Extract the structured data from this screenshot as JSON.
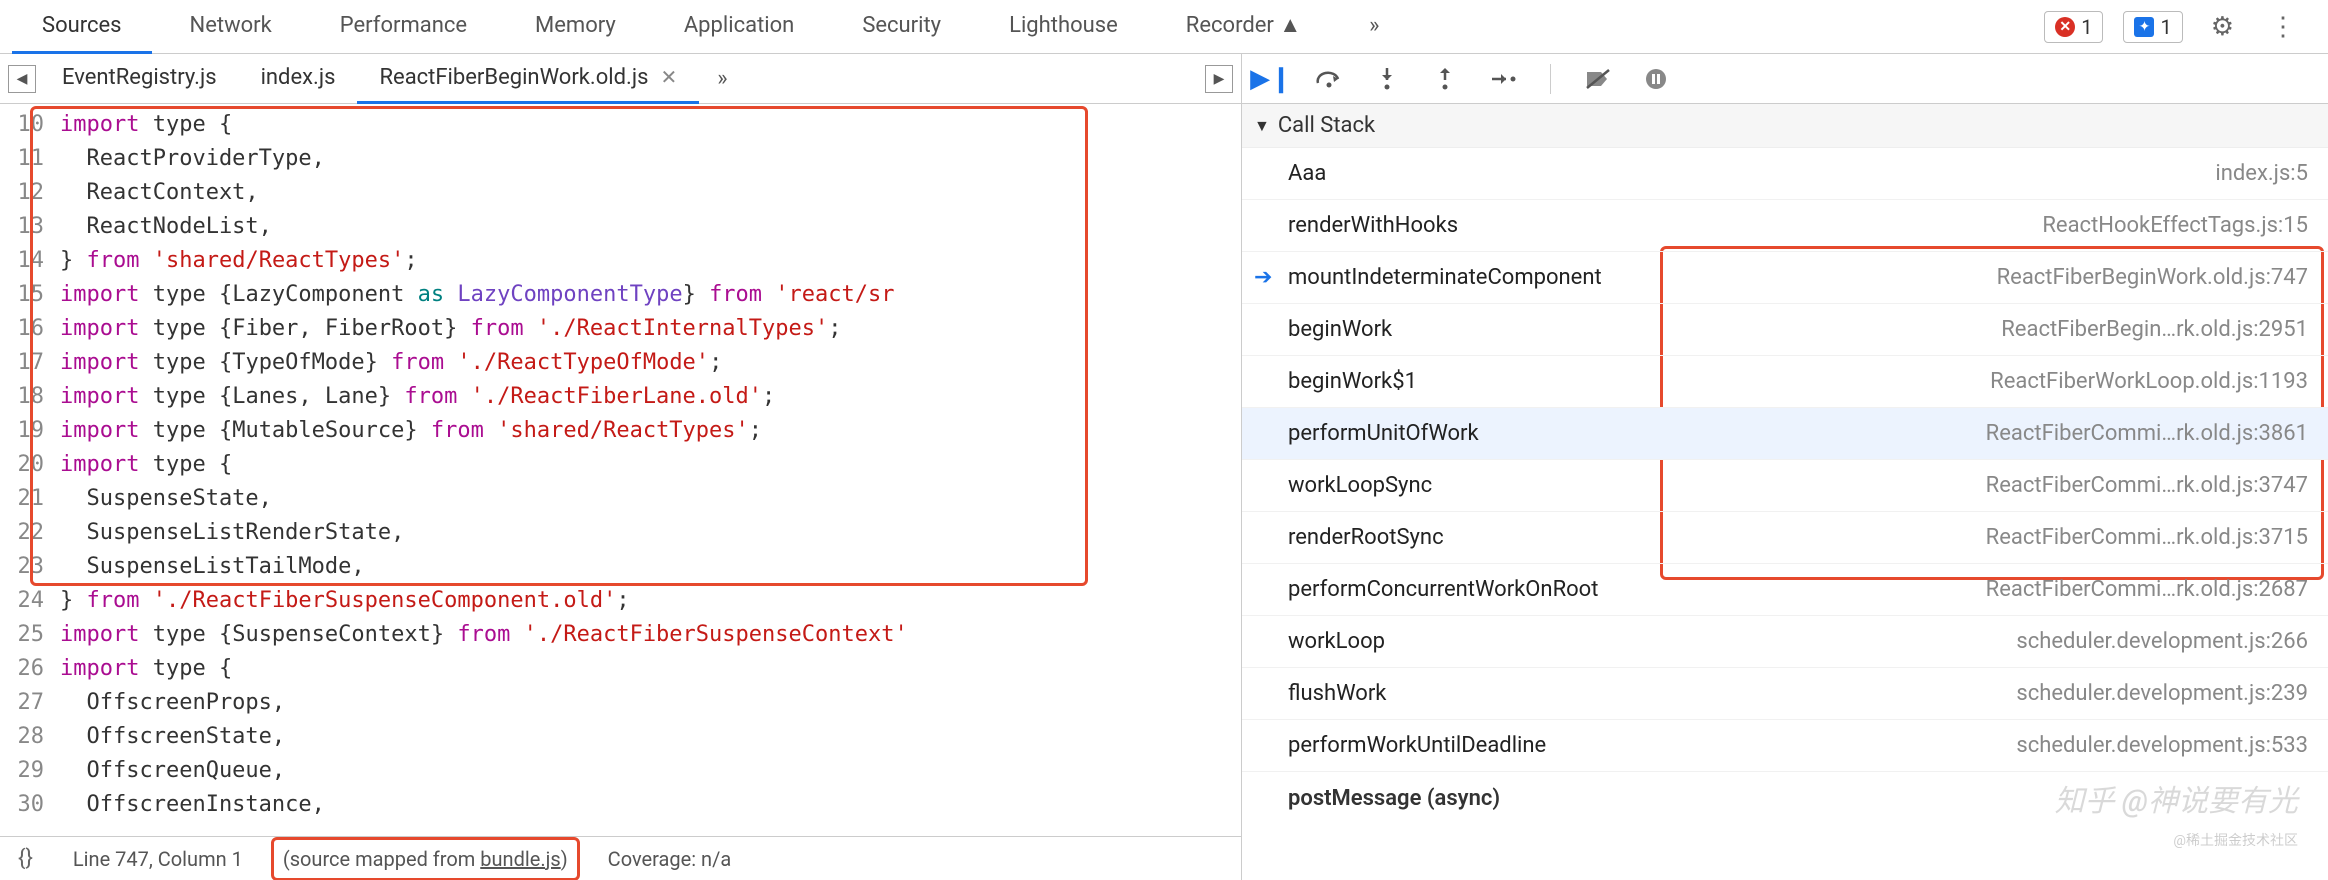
{
  "top_tabs": [
    "Sources",
    "Network",
    "Performance",
    "Memory",
    "Application",
    "Security",
    "Lighthouse",
    "Recorder ▲"
  ],
  "top_tabs_active": 0,
  "top_more": "»",
  "error_count": "1",
  "info_count": "1",
  "file_tabs": [
    {
      "label": "EventRegistry.js",
      "active": false,
      "close": false
    },
    {
      "label": "index.js",
      "active": false,
      "close": false
    },
    {
      "label": "ReactFiberBeginWork.old.js",
      "active": true,
      "close": true
    }
  ],
  "file_more": "»",
  "line_start": 10,
  "code_lines_html": [
    "<span class='kw'>import</span> type {",
    "  ReactProviderType,",
    "  ReactContext,",
    "  ReactNodeList,",
    "} <span class='kw'>from</span> <span class='str'>'shared/ReactTypes'</span>;",
    "<span class='kw'>import</span> type {LazyComponent <span class='tkn'>as</span> <span class='idn'>LazyComponentType</span>} <span class='kw'>from</span> <span class='str'>'react/sr</span>",
    "<span class='kw'>import</span> type {Fiber, FiberRoot} <span class='kw'>from</span> <span class='str'>'./ReactInternalTypes'</span>;",
    "<span class='kw'>import</span> type {TypeOfMode} <span class='kw'>from</span> <span class='str'>'./ReactTypeOfMode'</span>;",
    "<span class='kw'>import</span> type {Lanes, Lane} <span class='kw'>from</span> <span class='str'>'./ReactFiberLane.old'</span>;",
    "<span class='kw'>import</span> type {MutableSource} <span class='kw'>from</span> <span class='str'>'shared/ReactTypes'</span>;",
    "<span class='kw'>import</span> type {",
    "  SuspenseState,",
    "  SuspenseListRenderState,",
    "  SuspenseListTailMode,",
    "} <span class='kw'>from</span> <span class='str'>'./ReactFiberSuspenseComponent.old'</span>;",
    "<span class='kw'>import</span> type {SuspenseContext} <span class='kw'>from</span> <span class='str'>'./ReactFiberSuspenseContext'</span>",
    "<span class='kw'>import</span> type {",
    "  OffscreenProps,",
    "  OffscreenState,",
    "  OffscreenQueue,",
    "  OffscreenInstance,"
  ],
  "status": {
    "pos": "Line 747, Column 1",
    "map": "(source mapped from ",
    "map_link": "bundle.js",
    "cov": "Coverage: n/a"
  },
  "callstack_label": "Call Stack",
  "frames": [
    {
      "fn": "Aaa",
      "loc": "index.js:5",
      "cur": false,
      "sel": false
    },
    {
      "fn": "renderWithHooks",
      "loc": "ReactHookEffectTags.js:15",
      "cur": false,
      "sel": false
    },
    {
      "fn": "mountIndeterminateComponent",
      "loc": "ReactFiberBeginWork.old.js:747",
      "cur": true,
      "sel": false
    },
    {
      "fn": "beginWork",
      "loc": "ReactFiberBegin…rk.old.js:2951",
      "cur": false,
      "sel": false
    },
    {
      "fn": "beginWork$1",
      "loc": "ReactFiberWorkLoop.old.js:1193",
      "cur": false,
      "sel": false
    },
    {
      "fn": "performUnitOfWork",
      "loc": "ReactFiberCommi…rk.old.js:3861",
      "cur": false,
      "sel": true
    },
    {
      "fn": "workLoopSync",
      "loc": "ReactFiberCommi…rk.old.js:3747",
      "cur": false,
      "sel": false
    },
    {
      "fn": "renderRootSync",
      "loc": "ReactFiberCommi…rk.old.js:3715",
      "cur": false,
      "sel": false
    },
    {
      "fn": "performConcurrentWorkOnRoot",
      "loc": "ReactFiberCommi…rk.old.js:2687",
      "cur": false,
      "sel": false
    },
    {
      "fn": "workLoop",
      "loc": "scheduler.development.js:266",
      "cur": false,
      "sel": false
    },
    {
      "fn": "flushWork",
      "loc": "scheduler.development.js:239",
      "cur": false,
      "sel": false
    },
    {
      "fn": "performWorkUntilDeadline",
      "loc": "scheduler.development.js:533",
      "cur": false,
      "sel": false
    }
  ],
  "async_label": "postMessage (async)",
  "watermark": "知乎 @神说要有光",
  "watermark2": "@稀土掘金技术社区"
}
